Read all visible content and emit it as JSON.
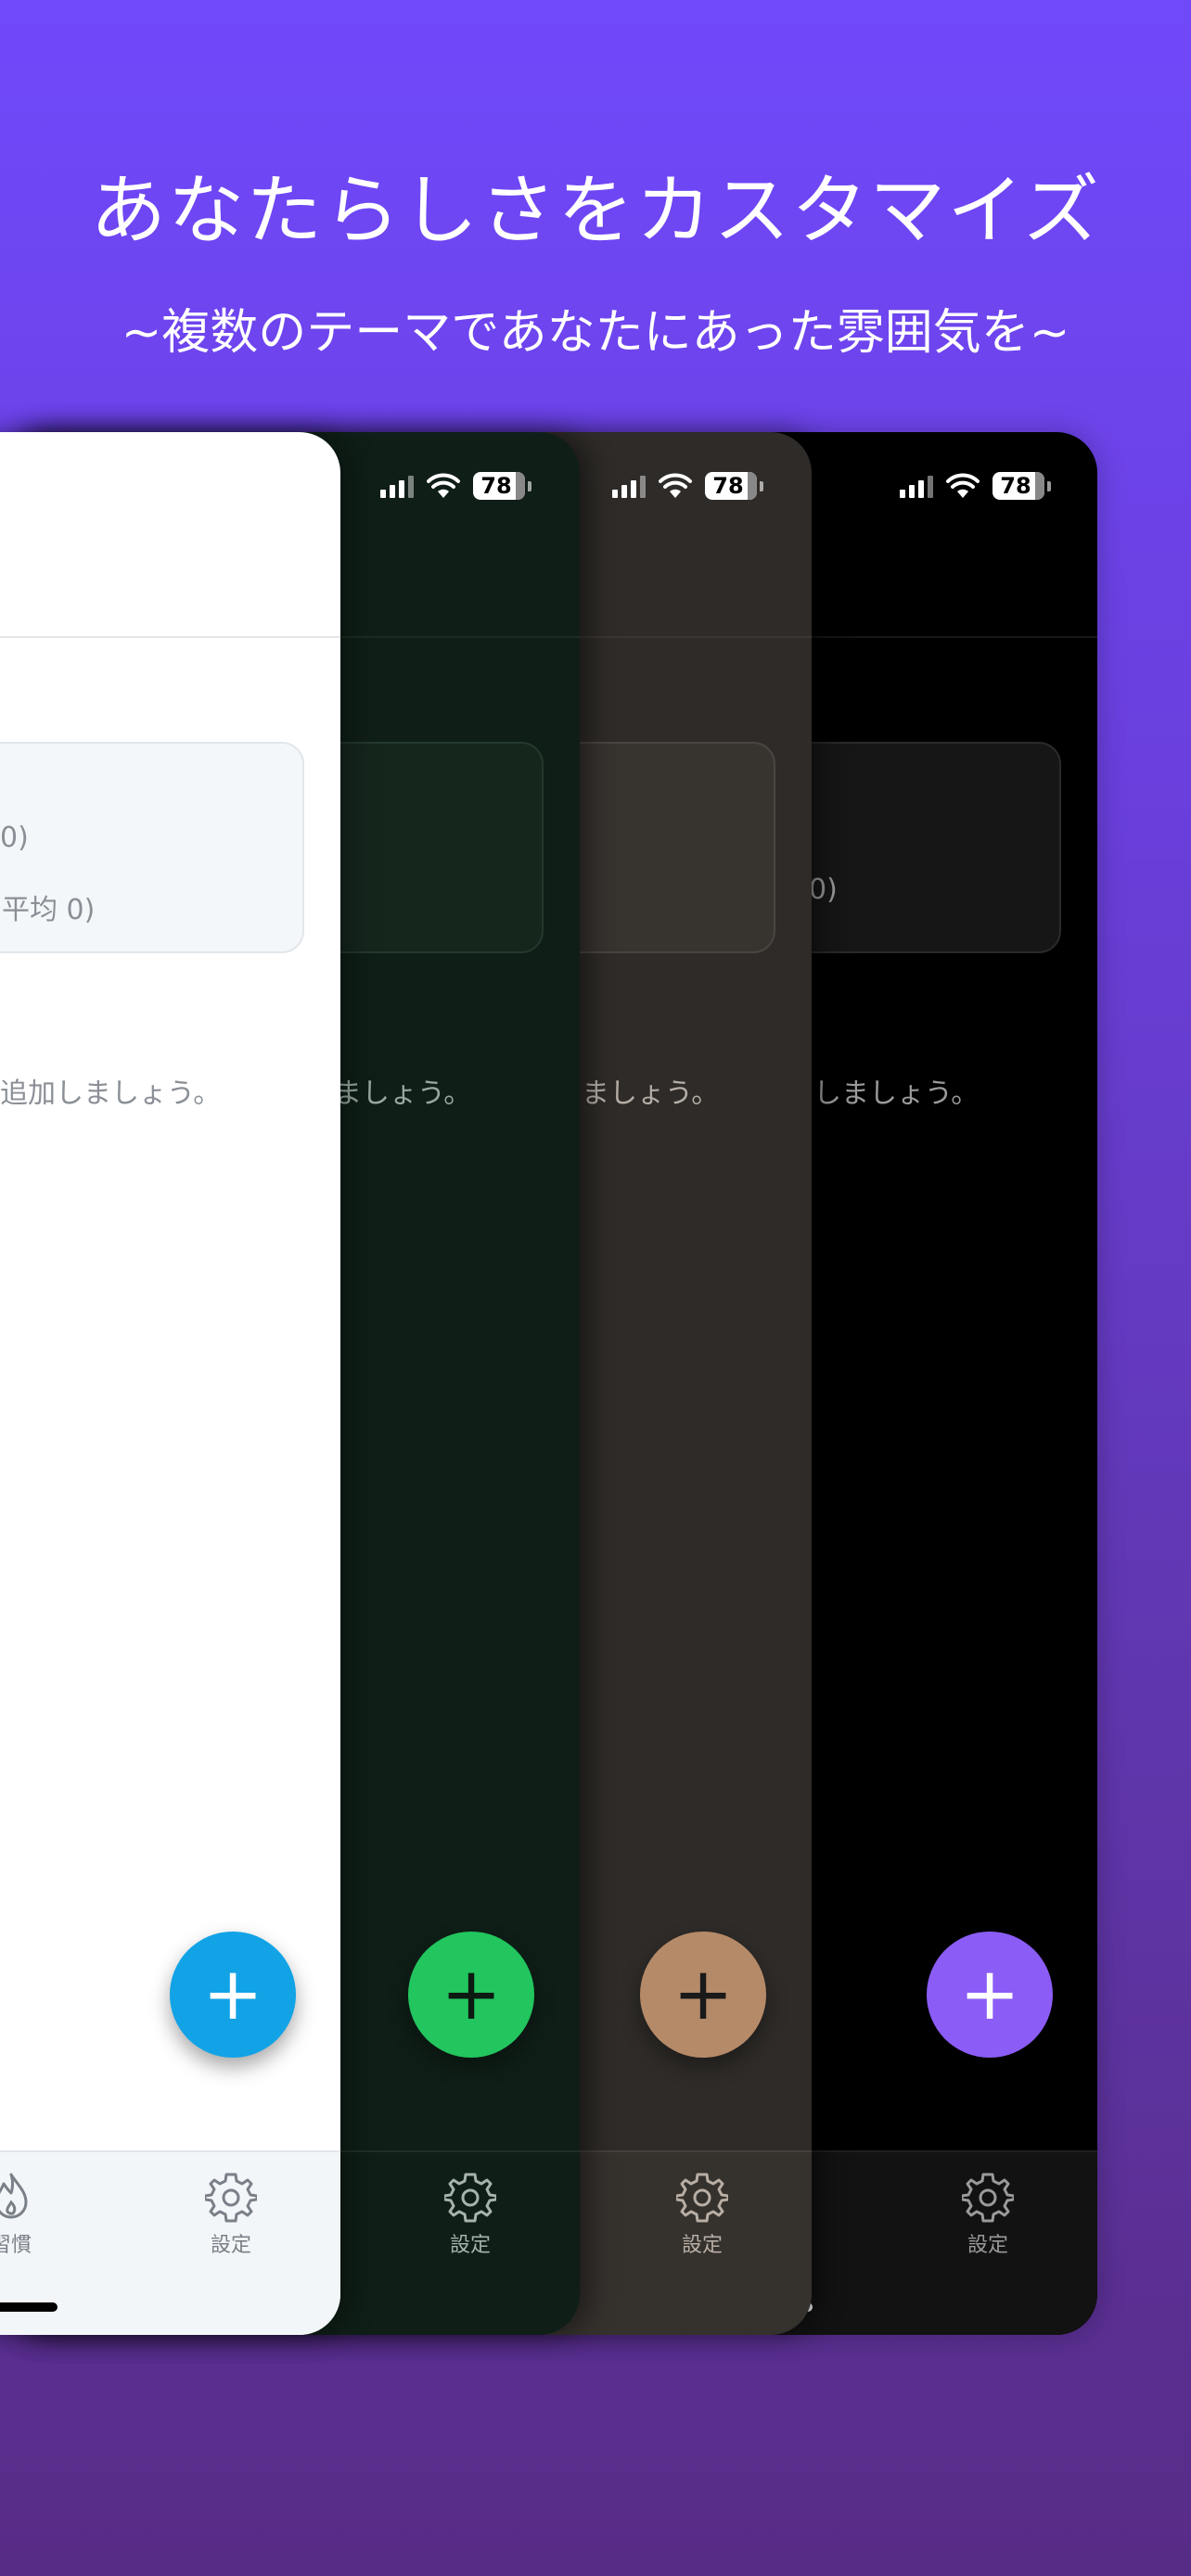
{
  "headline": "あなたらしさをカスタマイズ",
  "subline": "~複数のテーマであなたにあった雰囲気を~",
  "status": {
    "battery": "78"
  },
  "screen": {
    "card_line_1": "0)",
    "card_line_2_light": "平均 0)",
    "card_line_2_dark": "0)",
    "empty_light": "追加しましょう。",
    "empty_green": "ましょう。",
    "empty_brown": "ましょう。",
    "empty_black": "しましょう。",
    "fab_label": "+",
    "tab_habit_label": "習慣",
    "tab_settings_label": "設定"
  },
  "themes": [
    {
      "name": "light",
      "bg": "#ffffff",
      "accent": "#12a3e6"
    },
    {
      "name": "green",
      "bg": "#0f1e17",
      "accent": "#22c55e"
    },
    {
      "name": "brown",
      "bg": "#2e2b28",
      "accent": "#b58a69"
    },
    {
      "name": "black",
      "bg": "#000000",
      "accent": "#8b5cf6"
    }
  ]
}
